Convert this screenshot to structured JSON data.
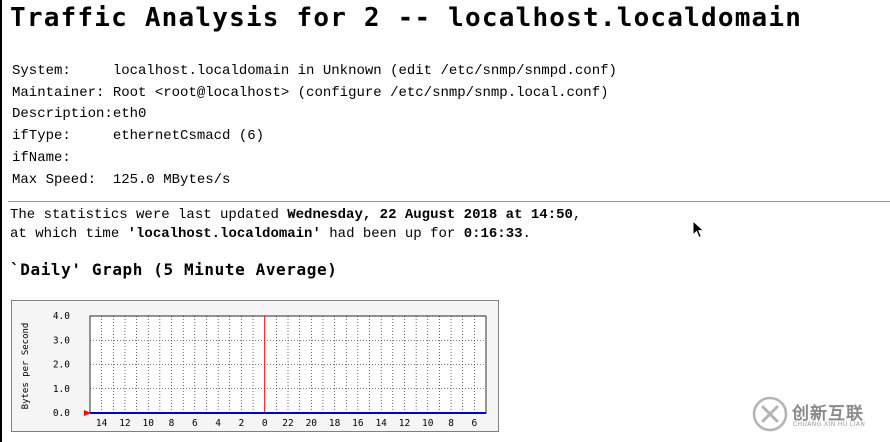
{
  "page": {
    "title": "Traffic Analysis for 2 -- localhost.localdomain"
  },
  "info": {
    "system_label": "System:",
    "system_value": "localhost.localdomain in Unknown (edit /etc/snmp/snmpd.conf)",
    "maintainer_label": "Maintainer:",
    "maintainer_value": "Root <root@localhost> (configure /etc/snmp/snmp.local.conf)",
    "description_label": "Description:",
    "description_value": "eth0",
    "iftype_label": "ifType:",
    "iftype_value": "ethernetCsmacd (6)",
    "ifname_label": "ifName:",
    "ifname_value": "",
    "maxspeed_label": "Max Speed:",
    "maxspeed_value": "125.0 MBytes/s"
  },
  "stats": {
    "line1_prefix": "The statistics were last updated ",
    "updated": "Wednesday, 22 August 2018 at 14:50",
    "line1_suffix": ",",
    "line2_prefix": "at which time ",
    "host": "'localhost.localdomain'",
    "line2_middle": " had been up for ",
    "uptime": "0:16:33",
    "line2_suffix": "."
  },
  "graph": {
    "heading": "`Daily' Graph (5 Minute Average)"
  },
  "chart_data": {
    "type": "line",
    "ylabel": "Bytes per Second",
    "ylim": [
      0,
      4
    ],
    "y_ticks": [
      "4.0",
      "3.0",
      "2.0",
      "1.0",
      "0.0"
    ],
    "x_ticks": [
      "14",
      "12",
      "10",
      "8",
      "6",
      "4",
      "2",
      "0",
      "22",
      "20",
      "18",
      "16",
      "14",
      "12",
      "10",
      "8",
      "6"
    ],
    "current_time_marker": "0",
    "grid": true,
    "series": [
      {
        "color": "#0000cc",
        "values": [
          0,
          0,
          0,
          0,
          0,
          0,
          0,
          0,
          0,
          0,
          0,
          0,
          0,
          0,
          0,
          0,
          0
        ]
      }
    ]
  },
  "watermark": {
    "brand_text": "创新互联",
    "brand_sub": "CHUANG XIN HU LIAN"
  },
  "colors": {
    "incoming": "#0000cc",
    "marker": "#ff0000",
    "grid": "#000000",
    "graph_background": "#f5f5f5"
  }
}
